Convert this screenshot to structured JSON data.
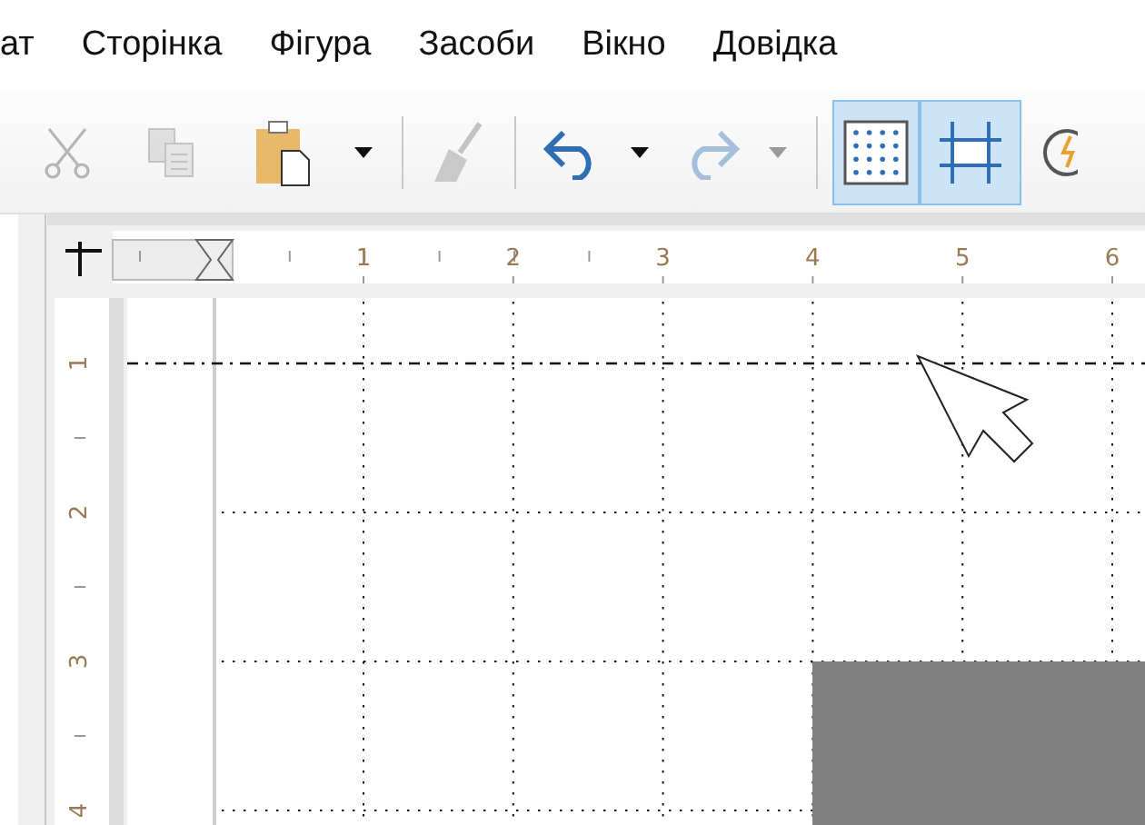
{
  "menu": [
    {
      "label": "ат"
    },
    {
      "label": "Сторінка"
    },
    {
      "label": "Фігура"
    },
    {
      "label": "Засоби"
    },
    {
      "label": "Вікно"
    },
    {
      "label": "Довідка"
    }
  ],
  "toolbar": [
    {
      "kind": "cut",
      "disabled": true,
      "selected": false
    },
    {
      "kind": "copy",
      "disabled": true,
      "selected": false
    },
    {
      "kind": "paste",
      "disabled": false,
      "selected": false
    },
    {
      "kind": "dropdown",
      "disabled": false,
      "selected": false
    },
    {
      "kind": "separator"
    },
    {
      "kind": "clone",
      "disabled": true,
      "selected": false
    },
    {
      "kind": "separator"
    },
    {
      "kind": "undo",
      "disabled": false,
      "selected": false
    },
    {
      "kind": "dropdown",
      "disabled": false,
      "selected": false
    },
    {
      "kind": "redo",
      "disabled": true,
      "selected": false
    },
    {
      "kind": "dropdown",
      "disabled": true,
      "selected": false
    },
    {
      "kind": "separator"
    },
    {
      "kind": "grid",
      "disabled": false,
      "selected": true
    },
    {
      "kind": "snap",
      "disabled": false,
      "selected": true
    },
    {
      "kind": "partial",
      "disabled": false,
      "selected": false
    }
  ],
  "ruler": {
    "horizontal_labels": [
      "1",
      "2",
      "3",
      "4",
      "5",
      "6"
    ],
    "vertical_labels": [
      "1",
      "2",
      "3",
      "4"
    ]
  }
}
